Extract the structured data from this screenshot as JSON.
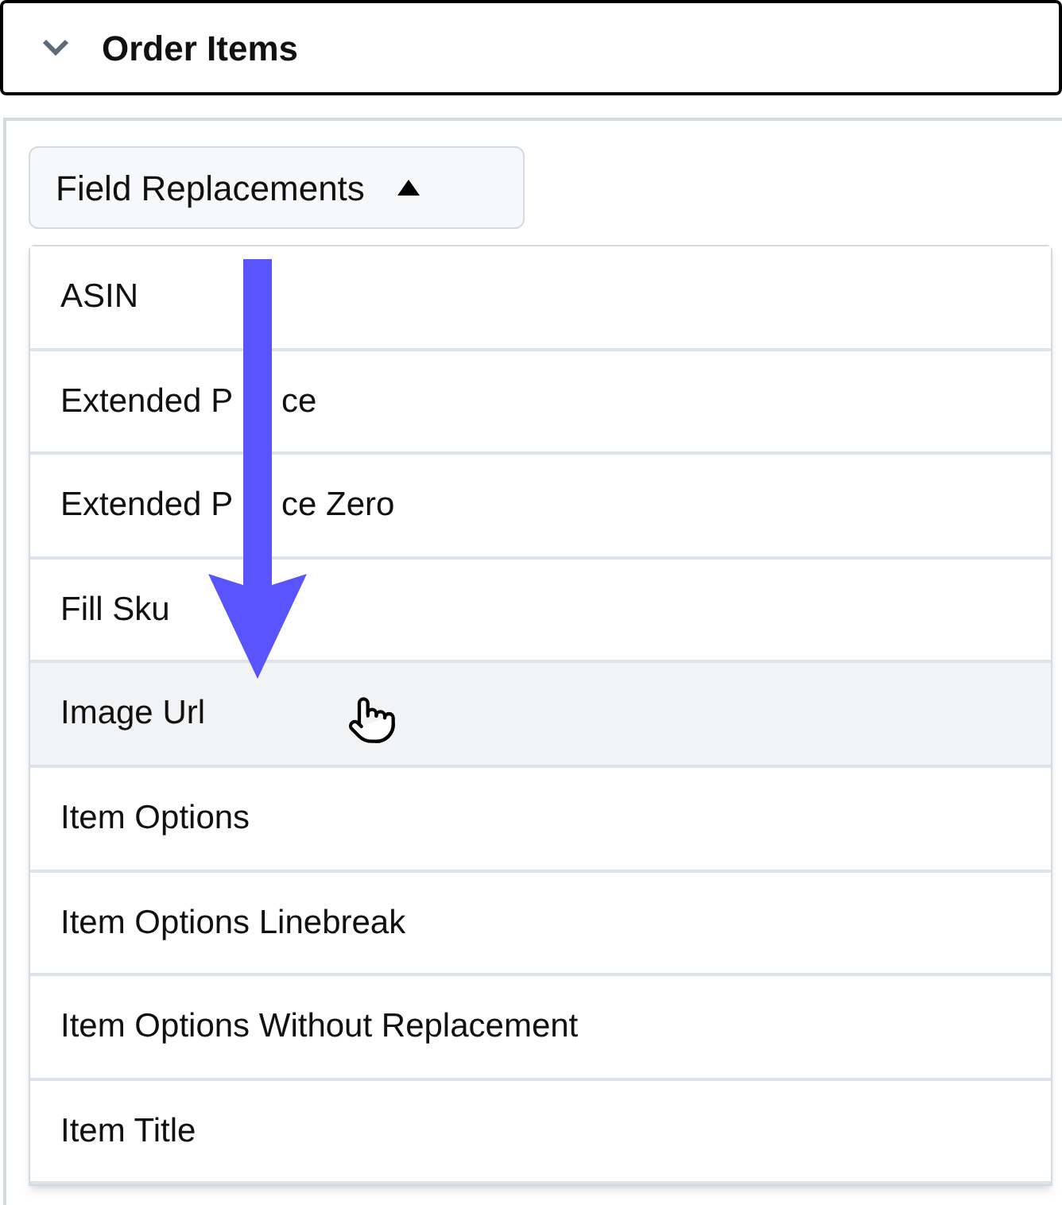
{
  "section": {
    "title": "Order Items",
    "expanded": true
  },
  "dropdown": {
    "label": "Field Replacements",
    "open": true
  },
  "menu_items": [
    {
      "label": "ASIN",
      "selected": false
    },
    {
      "label": "Extended P",
      "label_tail": "ce",
      "selected": false
    },
    {
      "label": "Extended P",
      "label_tail": "ce Zero",
      "selected": false
    },
    {
      "label": "Fill Sku",
      "selected": false
    },
    {
      "label": "Image Url",
      "selected": true
    },
    {
      "label": "Item Options",
      "selected": false
    },
    {
      "label": "Item Options Linebreak",
      "selected": false
    },
    {
      "label": "Item Options Without Replacement",
      "selected": false
    },
    {
      "label": "Item Title",
      "selected": false
    }
  ]
}
